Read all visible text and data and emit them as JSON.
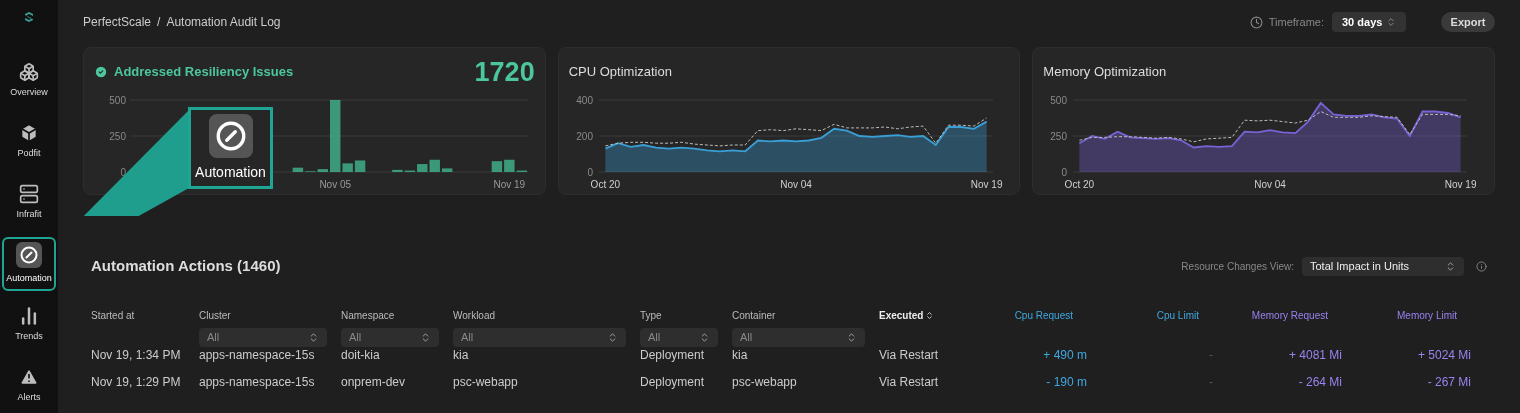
{
  "breadcrumb": {
    "root": "PerfectScale",
    "separator": "/",
    "page": "Automation Audit Log"
  },
  "timeframe": {
    "label": "Timeframe:",
    "value": "30 days"
  },
  "export_button": "Export",
  "sidebar": {
    "items": [
      {
        "label": "Overview",
        "kind": "overview",
        "selected": false
      },
      {
        "label": "Podfit",
        "kind": "podfit",
        "selected": false
      },
      {
        "label": "Infrafit",
        "kind": "infrafit",
        "selected": false
      },
      {
        "label": "Automation",
        "kind": "automation",
        "selected": true
      },
      {
        "label": "Trends",
        "kind": "trends",
        "selected": false
      },
      {
        "label": "Alerts",
        "kind": "alerts",
        "selected": false
      }
    ]
  },
  "callout": {
    "label": "Automation"
  },
  "cards": [
    {
      "title": "Addressed Resiliency Issues",
      "total": "1720",
      "chart_data": {
        "type": "bar",
        "categories": [
          null,
          null,
          null,
          null,
          null,
          null,
          null,
          null,
          null,
          null,
          null,
          null,
          null,
          null,
          null,
          null,
          "Nov 05",
          null,
          null,
          null,
          null,
          null,
          null,
          null,
          null,
          null,
          null,
          null,
          null,
          null,
          "Nov 19",
          null
        ],
        "series": [
          {
            "color": "#3fae8a",
            "values": [
              null,
              null,
              null,
              null,
              null,
              null,
              null,
              null,
              null,
              null,
              null,
              null,
              0,
              30,
              5,
              20,
              500,
              60,
              80,
              0,
              0,
              15,
              10,
              55,
              85,
              25,
              0,
              0,
              0,
              75,
              85,
              10
            ]
          }
        ],
        "ylim": [
          0,
          500
        ],
        "yticks": [
          0,
          250,
          500
        ]
      }
    },
    {
      "title": "CPU Optimization",
      "chart_data": {
        "type": "area",
        "categories": [
          "Oct 20",
          null,
          null,
          null,
          null,
          null,
          null,
          null,
          null,
          null,
          null,
          null,
          null,
          null,
          null,
          "Nov 04",
          null,
          null,
          null,
          null,
          null,
          null,
          null,
          null,
          null,
          null,
          null,
          null,
          null,
          null,
          "Nov 19"
        ],
        "series": [
          {
            "color": "#3a9fd6",
            "values": [
              130,
              160,
              140,
              150,
              135,
              130,
              135,
              130,
              120,
              115,
              120,
              115,
              175,
              170,
              175,
              170,
              175,
              190,
              240,
              230,
              200,
              195,
              200,
              205,
              195,
              200,
              150,
              250,
              250,
              240,
              280
            ]
          },
          {
            "type": "line",
            "line_style": "dashed",
            "color": "#bbbbbb",
            "values": [
              145,
              160,
              165,
              165,
              160,
              160,
              165,
              155,
              150,
              145,
              150,
              150,
              230,
              235,
              230,
              240,
              235,
              230,
              265,
              245,
              245,
              245,
              250,
              240,
              250,
              255,
              160,
              260,
              260,
              255,
              300
            ]
          }
        ],
        "ylim": [
          0,
          400
        ],
        "yticks": [
          0,
          200,
          400
        ]
      }
    },
    {
      "title": "Memory Optimization",
      "chart_data": {
        "type": "area",
        "categories": [
          "Oct 20",
          null,
          null,
          null,
          null,
          null,
          null,
          null,
          null,
          null,
          null,
          null,
          null,
          null,
          null,
          "Nov 04",
          null,
          null,
          null,
          null,
          null,
          null,
          null,
          null,
          null,
          null,
          null,
          null,
          null,
          null,
          "Nov 19"
        ],
        "series": [
          {
            "color": "#7a62d6",
            "values": [
              200,
              250,
              230,
              280,
              240,
              235,
              230,
              235,
              220,
              170,
              180,
              175,
              180,
              280,
              275,
              290,
              275,
              270,
              350,
              480,
              400,
              390,
              390,
              400,
              380,
              370,
              250,
              420,
              420,
              410,
              380
            ]
          },
          {
            "type": "line",
            "line_style": "dashed",
            "color": "#bbbbbb",
            "values": [
              220,
              240,
              240,
              245,
              245,
              240,
              235,
              240,
              230,
              210,
              230,
              235,
              240,
              360,
              355,
              360,
              350,
              340,
              360,
              420,
              380,
              380,
              380,
              390,
              385,
              380,
              260,
              400,
              400,
              400,
              390
            ]
          }
        ],
        "ylim": [
          0,
          500
        ],
        "yticks": [
          0,
          250,
          500
        ]
      }
    }
  ],
  "actions": {
    "title": "Automation Actions (1460)",
    "view_label": "Resource Changes View:",
    "view_value": "Total Impact in Units",
    "columns": [
      {
        "label": "Started at",
        "kind": "plain"
      },
      {
        "label": "Cluster",
        "kind": "filter",
        "filter": "All"
      },
      {
        "label": "Namespace",
        "kind": "filter",
        "filter": "All"
      },
      {
        "label": "Workload",
        "kind": "filter",
        "filter": "All"
      },
      {
        "label": "Type",
        "kind": "filter",
        "filter": "All"
      },
      {
        "label": "Container",
        "kind": "filter",
        "filter": "All"
      },
      {
        "label": "Executed",
        "kind": "sort"
      },
      {
        "label": "Cpu Request",
        "kind": "cpu"
      },
      {
        "label": "Cpu Limit",
        "kind": "cpu"
      },
      {
        "label": "Memory Request",
        "kind": "memory"
      },
      {
        "label": "Memory Limit",
        "kind": "memory"
      }
    ],
    "rows": [
      [
        "Nov 19, 1:34 PM",
        "apps-namespace-15s",
        "doit-kia",
        "kia",
        "Deployment",
        "kia",
        "Via Restart",
        "+ 490 m",
        "-",
        "+ 4081 Mi",
        "+ 5024 Mi"
      ],
      [
        "Nov 19, 1:29 PM",
        "apps-namespace-15s",
        "onprem-dev",
        "psc-webapp",
        "Deployment",
        "psc-webapp",
        "Via Restart",
        "- 190 m",
        "-",
        "- 264 Mi",
        "- 267 Mi"
      ]
    ]
  }
}
